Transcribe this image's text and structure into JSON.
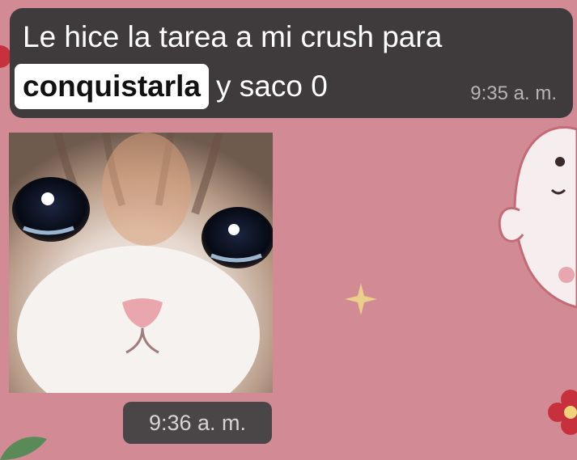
{
  "message": {
    "line1": "Le hice la tarea a mi crush para",
    "highlighted_word": "conquistarla",
    "line2_rest": "y saco 0",
    "time": "9:35 a. m."
  },
  "image_message": {
    "time": "9:36 a. m."
  },
  "colors": {
    "wallpaper": "#d28a95",
    "bubble": "#3f3b3c",
    "time_pill": "#4a4546"
  }
}
